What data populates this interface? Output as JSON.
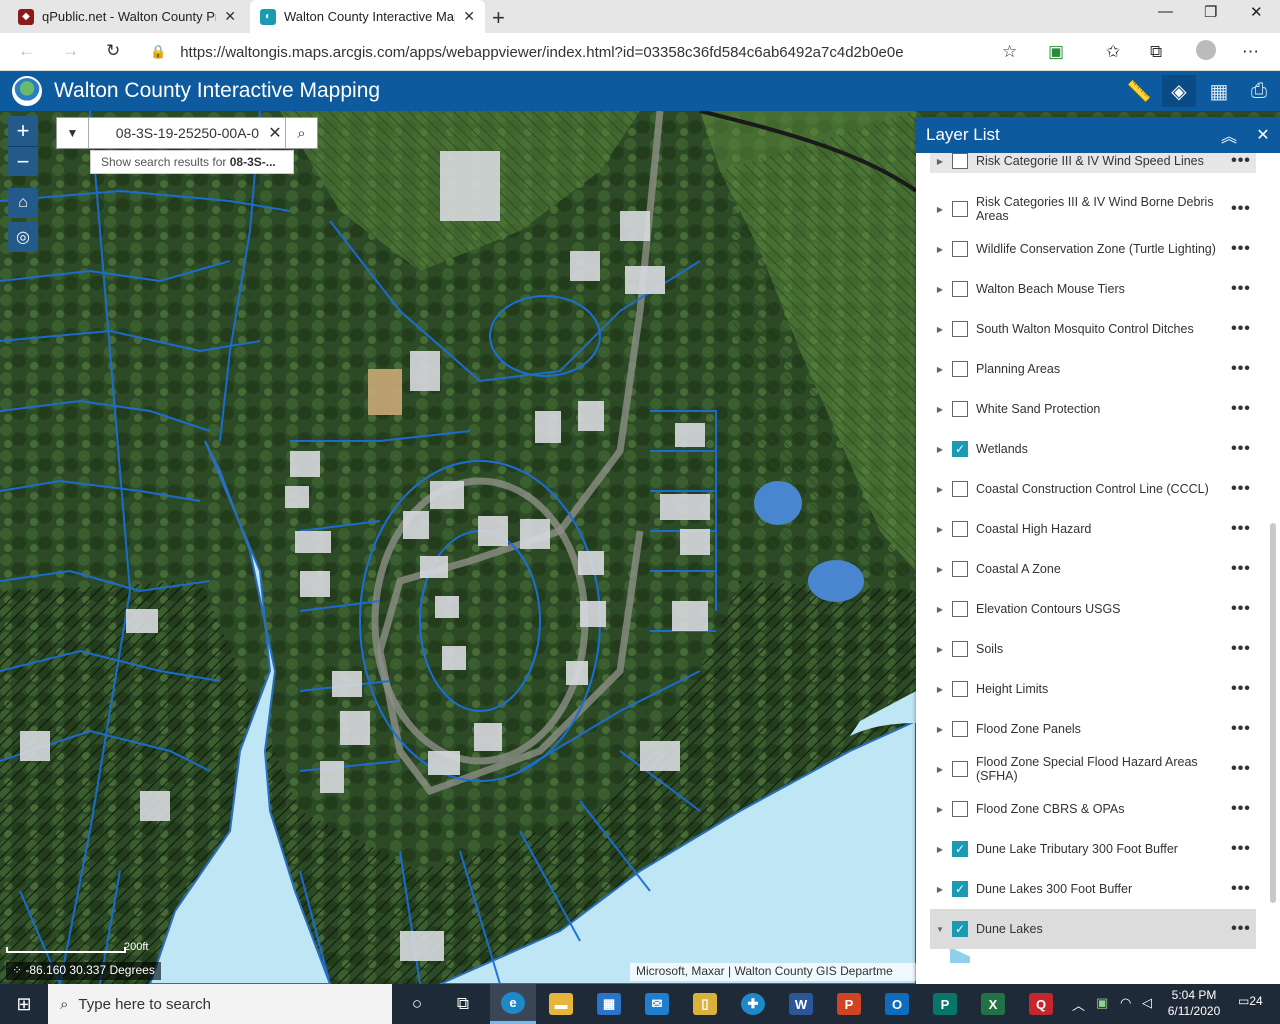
{
  "browser": {
    "tabs": [
      {
        "title": "qPublic.net - Walton County Pro",
        "favicon": "qpublic-icon"
      },
      {
        "title": "Walton County Interactive Mapp",
        "favicon": "arcgis-icon"
      }
    ],
    "close_glyph": "✕",
    "new_tab_glyph": "+",
    "url": "https://waltongis.maps.arcgis.com/apps/webappviewer/index.html?id=03358c36fd584c6ab6492a7c4d2b0e0e"
  },
  "app": {
    "title": "Walton County Interactive Mapping",
    "colors": {
      "header": "#0d5a9e",
      "accent": "#1a9bb3",
      "water": "#bfe6f5"
    }
  },
  "map": {
    "search_value": "08-3S-19-25250-00A-0",
    "suggest_prefix": "Show search results for ",
    "suggest_bold": "08-3S-...",
    "scale_label": "200ft",
    "coordinates": "-86.160 30.337 Degrees",
    "attribution": "Microsoft, Maxar | Walton County GIS Departme"
  },
  "layer_list": {
    "title": "Layer List",
    "items": [
      {
        "name": "Risk Categorie III & IV Wind Speed Lines",
        "checked": false
      },
      {
        "name": "Risk Categories III & IV Wind Borne Debris Areas",
        "checked": false
      },
      {
        "name": "Wildlife Conservation Zone (Turtle Lighting)",
        "checked": false
      },
      {
        "name": "Walton Beach Mouse Tiers",
        "checked": false
      },
      {
        "name": "South Walton Mosquito Control Ditches",
        "checked": false
      },
      {
        "name": "Planning Areas",
        "checked": false
      },
      {
        "name": "White Sand Protection",
        "checked": false
      },
      {
        "name": "Wetlands",
        "checked": true
      },
      {
        "name": "Coastal Construction Control Line (CCCL)",
        "checked": false
      },
      {
        "name": "Coastal High Hazard",
        "checked": false
      },
      {
        "name": "Coastal A Zone",
        "checked": false
      },
      {
        "name": "Elevation Contours USGS",
        "checked": false
      },
      {
        "name": "Soils",
        "checked": false
      },
      {
        "name": "Height Limits",
        "checked": false
      },
      {
        "name": "Flood Zone Panels",
        "checked": false
      },
      {
        "name": "Flood Zone Special Flood Hazard Areas (SFHA)",
        "checked": false
      },
      {
        "name": "Flood Zone CBRS & OPAs",
        "checked": false
      },
      {
        "name": "Dune Lake Tributary 300 Foot Buffer",
        "checked": true
      },
      {
        "name": "Dune Lakes 300 Foot Buffer",
        "checked": true
      },
      {
        "name": "Dune Lakes",
        "checked": true
      }
    ]
  },
  "taskbar": {
    "search_placeholder": "Type here to search",
    "time": "5:04 PM",
    "date": "6/11/2020",
    "notifications": "24"
  }
}
